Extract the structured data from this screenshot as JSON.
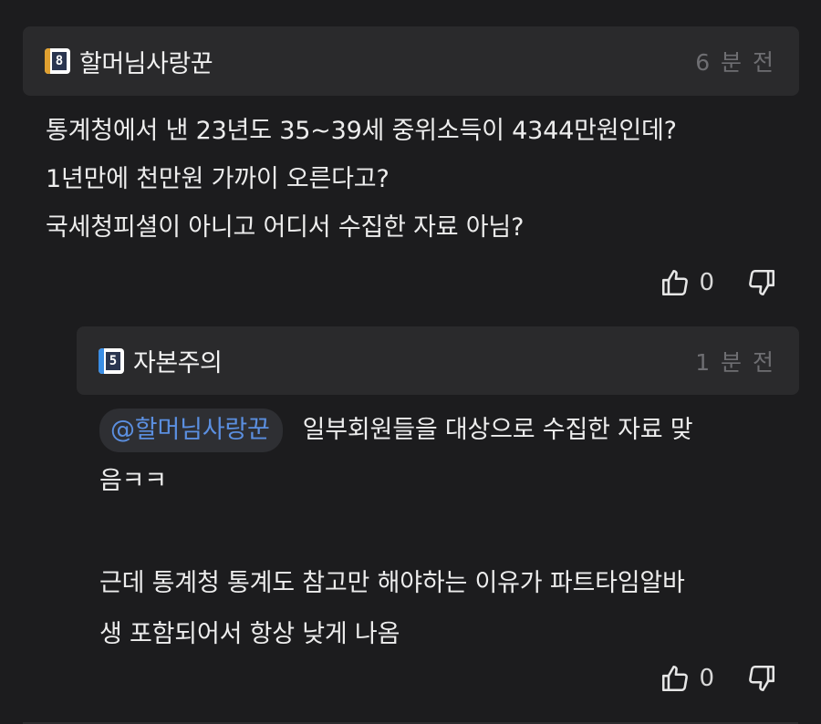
{
  "colors": {
    "background": "#1c1c1e",
    "header_bg": "#2a2a2c",
    "mention_text": "#5b8fe0",
    "badge_top_stripe": "#e0a030",
    "badge_reply_stripe": "#3a8ee6"
  },
  "top_comment": {
    "level": "8",
    "author": "할머님사랑꾼",
    "time": "6 분 전",
    "lines": [
      "통계청에서 낸 23년도 35~39세 중위소득이 4344만원인데?",
      "1년만에 천만원 가까이 오른다고?",
      "국세청피셜이 아니고 어디서 수집한 자료 아님?"
    ],
    "likes": "0",
    "like_icon": "thumbs-up-icon",
    "dislike_icon": "thumbs-down-icon"
  },
  "reply_comment": {
    "level": "5",
    "author": "자본주의",
    "time": "1 분 전",
    "mention": "@할머님사랑꾼",
    "line1": "일부회원들을 대상으로 수집한 자료 맞",
    "line2": "음ㅋㅋ",
    "line3": "근데 통계청 통계도 참고만 해야하는 이유가 파트타임알바",
    "line4": "생 포함되어서 항상 낮게 나옴",
    "likes": "0",
    "like_icon": "thumbs-up-icon",
    "dislike_icon": "thumbs-down-icon"
  }
}
